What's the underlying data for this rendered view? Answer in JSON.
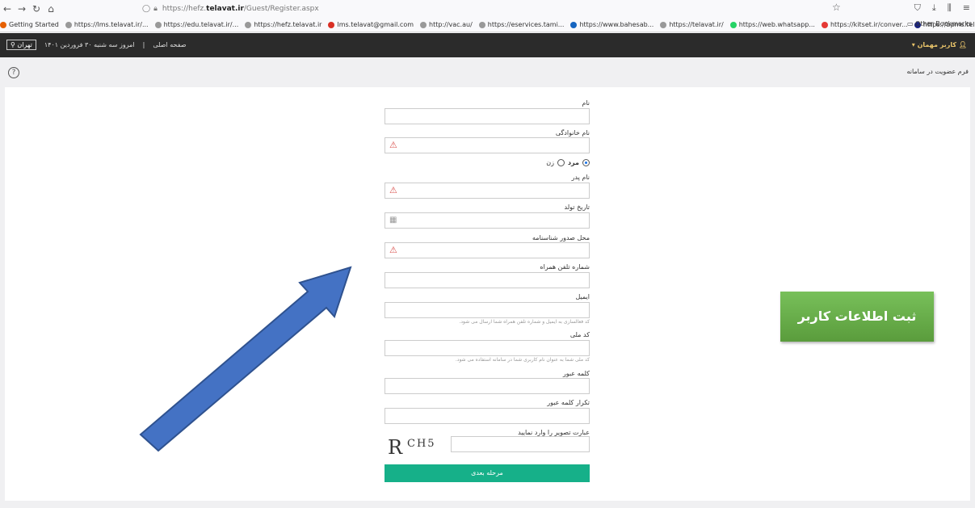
{
  "browser": {
    "url_prefix": "https://hefz.",
    "url_domain": "telavat.ir",
    "url_path": "/Guest/Register.aspx",
    "bookmarks": [
      "Getting Started",
      "https://lms.telavat.ir/...",
      "https://edu.telavat.ir/...",
      "https://hefz.telavat.ir",
      "lms.telavat@gmail.com",
      "http://vac.au/",
      "https://eservices.tami...",
      "https://www.bahesab...",
      "https://telavat.ir/",
      "https://web.whatsapp...",
      "https://kitset.ir/conver...",
      "https://bpms.telavat.ir/"
    ],
    "other_bookmarks": "Other Bookmarks"
  },
  "topbar": {
    "user": "کاربر مهمان",
    "home": "صفحه اصلی",
    "date": "امروز سه شنبه ۳۰ فروردین ۱۴۰۱",
    "city": "تهران"
  },
  "page": {
    "form_title": "فرم عضویت در سامانه"
  },
  "form": {
    "name_label": "نام",
    "family_label": "نام خانوادگی",
    "gender_male": "مرد",
    "gender_female": "زن",
    "father_label": "نام پدر",
    "birth_label": "تاریخ تولد",
    "birthplace_label": "محل صدور شناسنامه",
    "mobile_label": "شماره تلفن همراه",
    "email_label": "ایمیل",
    "email_hint": "کد فعالسازی به ایمیل و شماره تلفن همراه شما ارسال می شود.",
    "nid_label": "کد ملی",
    "nid_hint": "کد ملی شما به عنوان نام کاربری شما در سامانه استفاده می شود.",
    "password_label": "کلمه عبور",
    "repassword_label": "تکرار کلمه عبور",
    "captcha_label": "عبارت تصویر را وارد نمایید",
    "captcha_big": "R",
    "captcha_small": "CH5",
    "submit": "مرحله بعدی"
  },
  "annotation": {
    "badge": "ثبت اطلاعات کاربر",
    "arrow_color": "#4472c4",
    "badge_color": "#6ab04c"
  },
  "colors": {
    "accent": "#16b089",
    "topbar": "#2b2b2b",
    "warning": "#d9534f"
  }
}
